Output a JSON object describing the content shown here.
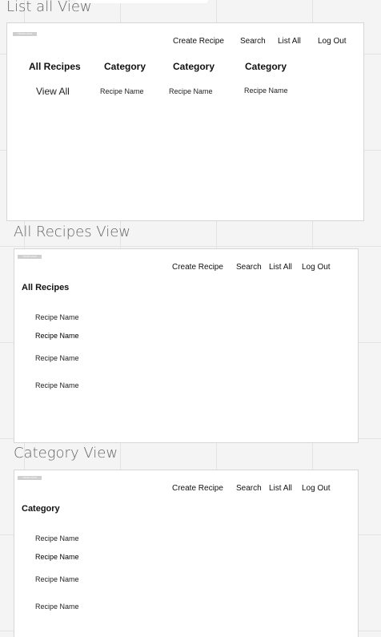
{
  "logo_text": "YOUR LOGO",
  "nav": {
    "create": "Create Recipe",
    "search": "Search",
    "list_all": "List All",
    "logout": "Log Out"
  },
  "list_all_view": {
    "title": "List all View",
    "columns": [
      {
        "heading": "All Recipes",
        "item": "View All"
      },
      {
        "heading": "Category",
        "item": "Recipe Name"
      },
      {
        "heading": "Category",
        "item": "Recipe Name"
      },
      {
        "heading": "Category",
        "item": "Recipe Name"
      }
    ]
  },
  "all_recipes_view": {
    "title": "All Recipes  View",
    "heading": "All Recipes",
    "items": [
      "Recipe Name",
      "Recipe Name",
      "Recipe Name",
      "Recipe Name"
    ]
  },
  "category_view": {
    "title": "Category  View",
    "heading": "Category",
    "items": [
      "Recipe Name",
      "Recipe Name",
      "Recipe Name",
      "Recipe Name"
    ]
  }
}
